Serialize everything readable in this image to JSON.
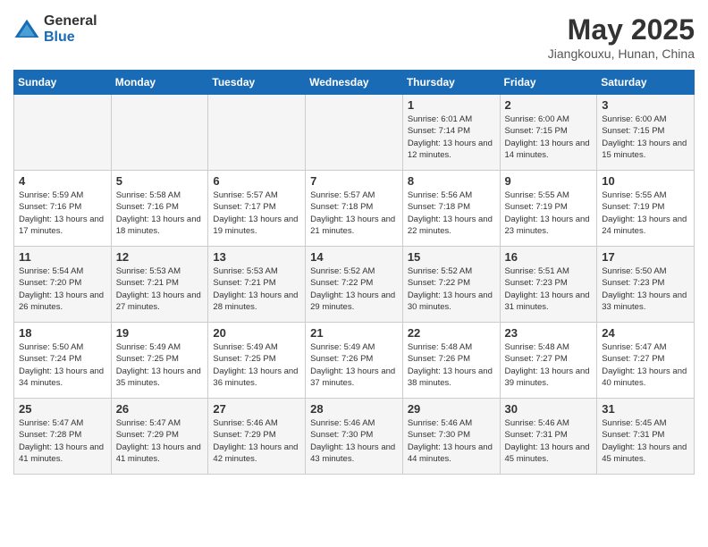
{
  "header": {
    "logo_general": "General",
    "logo_blue": "Blue",
    "month_year": "May 2025",
    "location": "Jiangkouxu, Hunan, China"
  },
  "weekdays": [
    "Sunday",
    "Monday",
    "Tuesday",
    "Wednesday",
    "Thursday",
    "Friday",
    "Saturday"
  ],
  "weeks": [
    [
      {
        "day": "",
        "sunrise": "",
        "sunset": "",
        "daylight": ""
      },
      {
        "day": "",
        "sunrise": "",
        "sunset": "",
        "daylight": ""
      },
      {
        "day": "",
        "sunrise": "",
        "sunset": "",
        "daylight": ""
      },
      {
        "day": "",
        "sunrise": "",
        "sunset": "",
        "daylight": ""
      },
      {
        "day": "1",
        "sunrise": "Sunrise: 6:01 AM",
        "sunset": "Sunset: 7:14 PM",
        "daylight": "Daylight: 13 hours and 12 minutes."
      },
      {
        "day": "2",
        "sunrise": "Sunrise: 6:00 AM",
        "sunset": "Sunset: 7:15 PM",
        "daylight": "Daylight: 13 hours and 14 minutes."
      },
      {
        "day": "3",
        "sunrise": "Sunrise: 6:00 AM",
        "sunset": "Sunset: 7:15 PM",
        "daylight": "Daylight: 13 hours and 15 minutes."
      }
    ],
    [
      {
        "day": "4",
        "sunrise": "Sunrise: 5:59 AM",
        "sunset": "Sunset: 7:16 PM",
        "daylight": "Daylight: 13 hours and 17 minutes."
      },
      {
        "day": "5",
        "sunrise": "Sunrise: 5:58 AM",
        "sunset": "Sunset: 7:16 PM",
        "daylight": "Daylight: 13 hours and 18 minutes."
      },
      {
        "day": "6",
        "sunrise": "Sunrise: 5:57 AM",
        "sunset": "Sunset: 7:17 PM",
        "daylight": "Daylight: 13 hours and 19 minutes."
      },
      {
        "day": "7",
        "sunrise": "Sunrise: 5:57 AM",
        "sunset": "Sunset: 7:18 PM",
        "daylight": "Daylight: 13 hours and 21 minutes."
      },
      {
        "day": "8",
        "sunrise": "Sunrise: 5:56 AM",
        "sunset": "Sunset: 7:18 PM",
        "daylight": "Daylight: 13 hours and 22 minutes."
      },
      {
        "day": "9",
        "sunrise": "Sunrise: 5:55 AM",
        "sunset": "Sunset: 7:19 PM",
        "daylight": "Daylight: 13 hours and 23 minutes."
      },
      {
        "day": "10",
        "sunrise": "Sunrise: 5:55 AM",
        "sunset": "Sunset: 7:19 PM",
        "daylight": "Daylight: 13 hours and 24 minutes."
      }
    ],
    [
      {
        "day": "11",
        "sunrise": "Sunrise: 5:54 AM",
        "sunset": "Sunset: 7:20 PM",
        "daylight": "Daylight: 13 hours and 26 minutes."
      },
      {
        "day": "12",
        "sunrise": "Sunrise: 5:53 AM",
        "sunset": "Sunset: 7:21 PM",
        "daylight": "Daylight: 13 hours and 27 minutes."
      },
      {
        "day": "13",
        "sunrise": "Sunrise: 5:53 AM",
        "sunset": "Sunset: 7:21 PM",
        "daylight": "Daylight: 13 hours and 28 minutes."
      },
      {
        "day": "14",
        "sunrise": "Sunrise: 5:52 AM",
        "sunset": "Sunset: 7:22 PM",
        "daylight": "Daylight: 13 hours and 29 minutes."
      },
      {
        "day": "15",
        "sunrise": "Sunrise: 5:52 AM",
        "sunset": "Sunset: 7:22 PM",
        "daylight": "Daylight: 13 hours and 30 minutes."
      },
      {
        "day": "16",
        "sunrise": "Sunrise: 5:51 AM",
        "sunset": "Sunset: 7:23 PM",
        "daylight": "Daylight: 13 hours and 31 minutes."
      },
      {
        "day": "17",
        "sunrise": "Sunrise: 5:50 AM",
        "sunset": "Sunset: 7:23 PM",
        "daylight": "Daylight: 13 hours and 33 minutes."
      }
    ],
    [
      {
        "day": "18",
        "sunrise": "Sunrise: 5:50 AM",
        "sunset": "Sunset: 7:24 PM",
        "daylight": "Daylight: 13 hours and 34 minutes."
      },
      {
        "day": "19",
        "sunrise": "Sunrise: 5:49 AM",
        "sunset": "Sunset: 7:25 PM",
        "daylight": "Daylight: 13 hours and 35 minutes."
      },
      {
        "day": "20",
        "sunrise": "Sunrise: 5:49 AM",
        "sunset": "Sunset: 7:25 PM",
        "daylight": "Daylight: 13 hours and 36 minutes."
      },
      {
        "day": "21",
        "sunrise": "Sunrise: 5:49 AM",
        "sunset": "Sunset: 7:26 PM",
        "daylight": "Daylight: 13 hours and 37 minutes."
      },
      {
        "day": "22",
        "sunrise": "Sunrise: 5:48 AM",
        "sunset": "Sunset: 7:26 PM",
        "daylight": "Daylight: 13 hours and 38 minutes."
      },
      {
        "day": "23",
        "sunrise": "Sunrise: 5:48 AM",
        "sunset": "Sunset: 7:27 PM",
        "daylight": "Daylight: 13 hours and 39 minutes."
      },
      {
        "day": "24",
        "sunrise": "Sunrise: 5:47 AM",
        "sunset": "Sunset: 7:27 PM",
        "daylight": "Daylight: 13 hours and 40 minutes."
      }
    ],
    [
      {
        "day": "25",
        "sunrise": "Sunrise: 5:47 AM",
        "sunset": "Sunset: 7:28 PM",
        "daylight": "Daylight: 13 hours and 41 minutes."
      },
      {
        "day": "26",
        "sunrise": "Sunrise: 5:47 AM",
        "sunset": "Sunset: 7:29 PM",
        "daylight": "Daylight: 13 hours and 41 minutes."
      },
      {
        "day": "27",
        "sunrise": "Sunrise: 5:46 AM",
        "sunset": "Sunset: 7:29 PM",
        "daylight": "Daylight: 13 hours and 42 minutes."
      },
      {
        "day": "28",
        "sunrise": "Sunrise: 5:46 AM",
        "sunset": "Sunset: 7:30 PM",
        "daylight": "Daylight: 13 hours and 43 minutes."
      },
      {
        "day": "29",
        "sunrise": "Sunrise: 5:46 AM",
        "sunset": "Sunset: 7:30 PM",
        "daylight": "Daylight: 13 hours and 44 minutes."
      },
      {
        "day": "30",
        "sunrise": "Sunrise: 5:46 AM",
        "sunset": "Sunset: 7:31 PM",
        "daylight": "Daylight: 13 hours and 45 minutes."
      },
      {
        "day": "31",
        "sunrise": "Sunrise: 5:45 AM",
        "sunset": "Sunset: 7:31 PM",
        "daylight": "Daylight: 13 hours and 45 minutes."
      }
    ]
  ]
}
